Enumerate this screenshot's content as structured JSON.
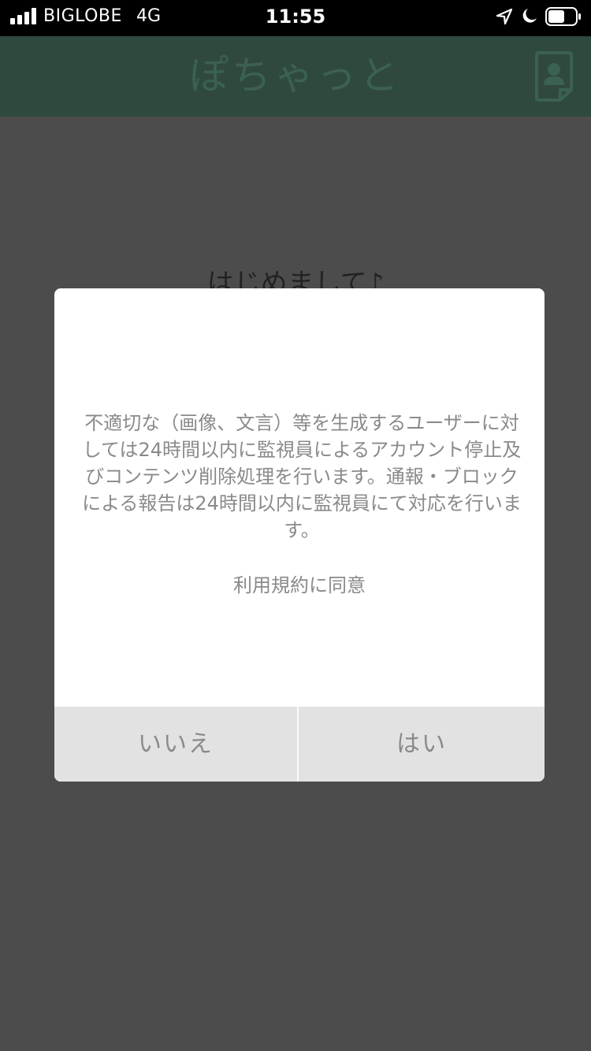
{
  "status_bar": {
    "carrier": "BIGLOBE",
    "network": "4G",
    "time": "11:55"
  },
  "header": {
    "title": "ぽちゃっと"
  },
  "background": {
    "greeting": "はじめまして♪"
  },
  "dialog": {
    "message": "不適切な（画像、文言）等を生成するユーザーに対しては24時間以内に監視員によるアカウント停止及びコンテンツ削除処理を行います。通報・ブロックによる報告は24時間以内に監視員にて対応を行います。",
    "agree_text": "利用規約に同意",
    "no_label": "いいえ",
    "yes_label": "はい"
  },
  "colors": {
    "header_bg": "#30493e",
    "overlay_bg": "#4c4c4c",
    "dialog_text": "#8a8a8a",
    "button_bg": "#e2e2e2"
  }
}
